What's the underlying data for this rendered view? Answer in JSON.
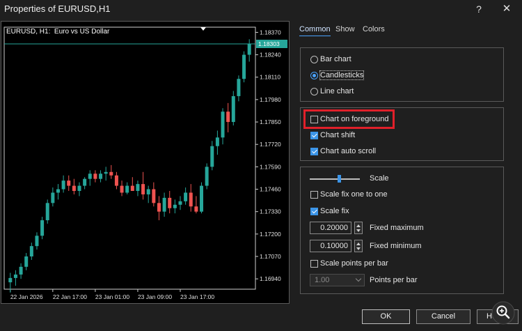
{
  "window": {
    "title": "Properties of EURUSD,H1",
    "help_label": "?",
    "close_label": "✕"
  },
  "chart": {
    "title": "EURUSD, H1:  Euro vs US Dollar",
    "current_price": "1.18303",
    "price_ticks": [
      "1.18370",
      "1.18240",
      "1.18110",
      "1.17980",
      "1.17850",
      "1.17720",
      "1.17590",
      "1.17460",
      "1.17330",
      "1.17200",
      "1.17070",
      "1.16940"
    ],
    "time_ticks": [
      "22 Jan 2026",
      "22 Jan 17:00",
      "23 Jan 01:00",
      "23 Jan 09:00",
      "23 Jan 17:00"
    ],
    "colors": {
      "bull": "#26a69a",
      "bear": "#ef5350",
      "grid": "#cfcfcf",
      "background": "#000000"
    }
  },
  "chart_data": {
    "type": "candlestick",
    "ylim": [
      1.1688,
      1.184
    ],
    "candles": [
      {
        "o": 1.1692,
        "h": 1.16975,
        "l": 1.1686,
        "c": 1.16945
      },
      {
        "o": 1.16945,
        "h": 1.1699,
        "l": 1.169,
        "c": 1.16965
      },
      {
        "o": 1.16965,
        "h": 1.1703,
        "l": 1.1694,
        "c": 1.1701
      },
      {
        "o": 1.1701,
        "h": 1.1709,
        "l": 1.1699,
        "c": 1.1707
      },
      {
        "o": 1.1707,
        "h": 1.1715,
        "l": 1.1705,
        "c": 1.1713
      },
      {
        "o": 1.1713,
        "h": 1.1721,
        "l": 1.1711,
        "c": 1.1719
      },
      {
        "o": 1.1719,
        "h": 1.173,
        "l": 1.1717,
        "c": 1.1728
      },
      {
        "o": 1.1728,
        "h": 1.174,
        "l": 1.1726,
        "c": 1.1738
      },
      {
        "o": 1.1738,
        "h": 1.1747,
        "l": 1.1736,
        "c": 1.1744
      },
      {
        "o": 1.1744,
        "h": 1.1749,
        "l": 1.174,
        "c": 1.1746
      },
      {
        "o": 1.1746,
        "h": 1.1754,
        "l": 1.1744,
        "c": 1.1751
      },
      {
        "o": 1.1751,
        "h": 1.1754,
        "l": 1.1745,
        "c": 1.1748
      },
      {
        "o": 1.1748,
        "h": 1.1752,
        "l": 1.1743,
        "c": 1.1745
      },
      {
        "o": 1.1745,
        "h": 1.175,
        "l": 1.1742,
        "c": 1.1748
      },
      {
        "o": 1.1748,
        "h": 1.1753,
        "l": 1.1746,
        "c": 1.1752
      },
      {
        "o": 1.1752,
        "h": 1.1757,
        "l": 1.1748,
        "c": 1.1755
      },
      {
        "o": 1.1755,
        "h": 1.1757,
        "l": 1.175,
        "c": 1.1752
      },
      {
        "o": 1.1752,
        "h": 1.1757,
        "l": 1.175,
        "c": 1.1755
      },
      {
        "o": 1.1755,
        "h": 1.1759,
        "l": 1.1751,
        "c": 1.1756
      },
      {
        "o": 1.1756,
        "h": 1.176,
        "l": 1.1752,
        "c": 1.1754
      },
      {
        "o": 1.1754,
        "h": 1.1756,
        "l": 1.1746,
        "c": 1.1748
      },
      {
        "o": 1.1748,
        "h": 1.1751,
        "l": 1.1742,
        "c": 1.1744
      },
      {
        "o": 1.1744,
        "h": 1.175,
        "l": 1.1743,
        "c": 1.1748
      },
      {
        "o": 1.1748,
        "h": 1.1753,
        "l": 1.1746,
        "c": 1.1745
      },
      {
        "o": 1.1745,
        "h": 1.1751,
        "l": 1.1742,
        "c": 1.1749
      },
      {
        "o": 1.1749,
        "h": 1.1756,
        "l": 1.174,
        "c": 1.1743
      },
      {
        "o": 1.1743,
        "h": 1.1748,
        "l": 1.1738,
        "c": 1.1746
      },
      {
        "o": 1.1746,
        "h": 1.175,
        "l": 1.1736,
        "c": 1.1738
      },
      {
        "o": 1.1738,
        "h": 1.1742,
        "l": 1.1728,
        "c": 1.1733
      },
      {
        "o": 1.1733,
        "h": 1.1744,
        "l": 1.173,
        "c": 1.1741
      },
      {
        "o": 1.1741,
        "h": 1.1745,
        "l": 1.1732,
        "c": 1.1735
      },
      {
        "o": 1.1735,
        "h": 1.174,
        "l": 1.1732,
        "c": 1.1737
      },
      {
        "o": 1.1737,
        "h": 1.1742,
        "l": 1.1734,
        "c": 1.1739
      },
      {
        "o": 1.1739,
        "h": 1.1747,
        "l": 1.1737,
        "c": 1.1744
      },
      {
        "o": 1.1744,
        "h": 1.1749,
        "l": 1.1733,
        "c": 1.1736
      },
      {
        "o": 1.1736,
        "h": 1.1742,
        "l": 1.1732,
        "c": 1.1733
      },
      {
        "o": 1.1733,
        "h": 1.175,
        "l": 1.1732,
        "c": 1.1748
      },
      {
        "o": 1.1748,
        "h": 1.1761,
        "l": 1.1746,
        "c": 1.1759
      },
      {
        "o": 1.1759,
        "h": 1.1774,
        "l": 1.1757,
        "c": 1.1771
      },
      {
        "o": 1.1771,
        "h": 1.178,
        "l": 1.1766,
        "c": 1.1776
      },
      {
        "o": 1.1776,
        "h": 1.1793,
        "l": 1.1772,
        "c": 1.1791
      },
      {
        "o": 1.1791,
        "h": 1.1796,
        "l": 1.1779,
        "c": 1.1785
      },
      {
        "o": 1.1785,
        "h": 1.1803,
        "l": 1.1783,
        "c": 1.18
      },
      {
        "o": 1.18,
        "h": 1.1812,
        "l": 1.1797,
        "c": 1.181
      },
      {
        "o": 1.181,
        "h": 1.1826,
        "l": 1.1808,
        "c": 1.1824
      },
      {
        "o": 1.1824,
        "h": 1.1833,
        "l": 1.182,
        "c": 1.18303
      }
    ]
  },
  "tabs": [
    {
      "label": "Common"
    },
    {
      "label": "Show"
    },
    {
      "label": "Colors"
    }
  ],
  "chart_type": {
    "options": [
      {
        "label": "Bar chart",
        "selected": false
      },
      {
        "label": "Candlesticks",
        "selected": true
      },
      {
        "label": "Line chart",
        "selected": false
      }
    ]
  },
  "options": [
    {
      "label": "Chart on foreground",
      "checked": false
    },
    {
      "label": "Chart shift",
      "checked": true
    },
    {
      "label": "Chart auto scroll",
      "checked": true
    }
  ],
  "scale": {
    "label": "Scale",
    "level": 0.55,
    "fix_one_to_one": {
      "label": "Scale fix one to one",
      "checked": false
    },
    "fix": {
      "label": "Scale fix",
      "checked": true
    },
    "fixed_max": {
      "value": "0.20000",
      "label": "Fixed maximum"
    },
    "fixed_min": {
      "value": "0.10000",
      "label": "Fixed minimum"
    },
    "points_per_bar_check": {
      "label": "Scale points per bar",
      "checked": false
    },
    "points_per_bar": {
      "value": "1.00",
      "label": "Points per bar"
    }
  },
  "buttons": {
    "ok": "OK",
    "cancel": "Cancel",
    "help": "Help"
  }
}
